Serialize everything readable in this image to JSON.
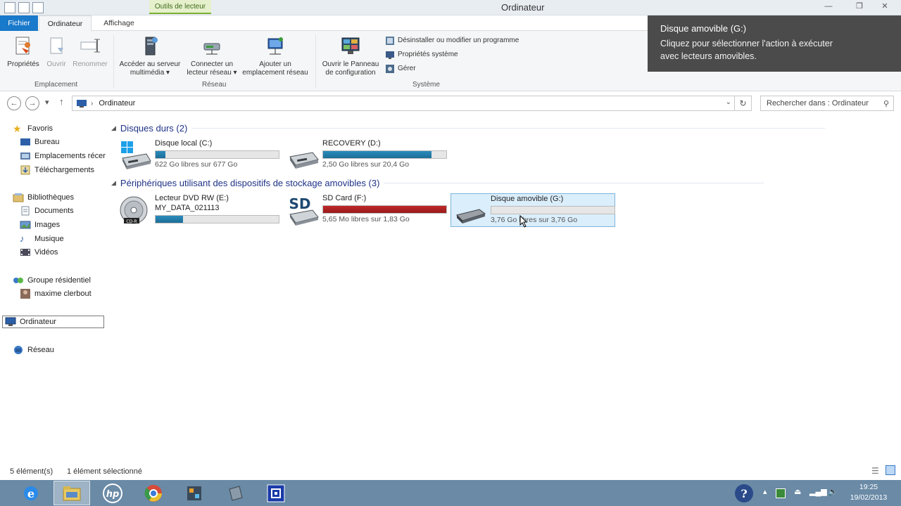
{
  "window": {
    "title": "Ordinateur",
    "context_tab": "Outils de lecteur"
  },
  "ribbon_tabs": {
    "file": "Fichier",
    "computer": "Ordinateur",
    "view": "Affichage"
  },
  "ribbon": {
    "properties": "Propriétés",
    "open": "Ouvrir",
    "rename": "Renommer",
    "media_server_l1": "Accéder au serveur",
    "media_server_l2": "multimédia ▾",
    "map_drive_l1": "Connecter un",
    "map_drive_l2": "lecteur réseau ▾",
    "add_location_l1": "Ajouter un",
    "add_location_l2": "emplacement réseau",
    "control_panel_l1": "Ouvrir le Panneau",
    "control_panel_l2": "de configuration",
    "uninstall": "Désinstaller ou modifier un programme",
    "system_properties": "Propriétés système",
    "manage": "Gérer",
    "group_location": "Emplacement",
    "group_network": "Réseau",
    "group_system": "Système"
  },
  "toast": {
    "title": "Disque amovible (G:)",
    "body_l1": "Cliquez pour sélectionner l'action à exécuter",
    "body_l2": "avec lecteurs amovibles."
  },
  "address": {
    "path": "Ordinateur",
    "search_placeholder": "Rechercher dans : Ordinateur"
  },
  "nav": {
    "favorites": "Favoris",
    "desktop": "Bureau",
    "recent": "Emplacements récents",
    "downloads": "Téléchargements",
    "libraries": "Bibliothèques",
    "documents": "Documents",
    "images": "Images",
    "music": "Musique",
    "videos": "Vidéos",
    "homegroup": "Groupe résidentiel",
    "user": "maxime clerbout",
    "computer": "Ordinateur",
    "network": "Réseau"
  },
  "groups": {
    "hard_drives": "Disques durs (2)",
    "removable": "Périphériques utilisant des dispositifs de stockage amovibles (3)"
  },
  "drives": [
    {
      "name": "Disque local (C:)",
      "label": "",
      "free": "622 Go libres sur 677 Go",
      "used_fraction": 0.08,
      "color": "#1d6e96"
    },
    {
      "name": "RECOVERY (D:)",
      "label": "",
      "free": "2,50 Go libres sur 20,4 Go",
      "used_fraction": 0.88,
      "color": "#1d6e96"
    },
    {
      "name": "Lecteur DVD RW (E:)",
      "label": "MY_DATA_021113",
      "free": "",
      "used_fraction": 0.22,
      "color": "#1d6e96"
    },
    {
      "name": "SD Card (F:)",
      "label": "",
      "free": "5,65 Mo libres sur 1,83 Go",
      "used_fraction": 1.0,
      "color": "#b02020"
    },
    {
      "name": "Disque amovible (G:)",
      "label": "",
      "free": "3,76 Go libres sur 3,76 Go",
      "used_fraction": 0.0,
      "color": "#1d6e96"
    }
  ],
  "status": {
    "count": "5 élément(s)",
    "selected": "1 élément sélectionné"
  },
  "clock": {
    "time": "19:25",
    "date": "19/02/2013"
  },
  "icons": {
    "sd_label": "SD"
  }
}
